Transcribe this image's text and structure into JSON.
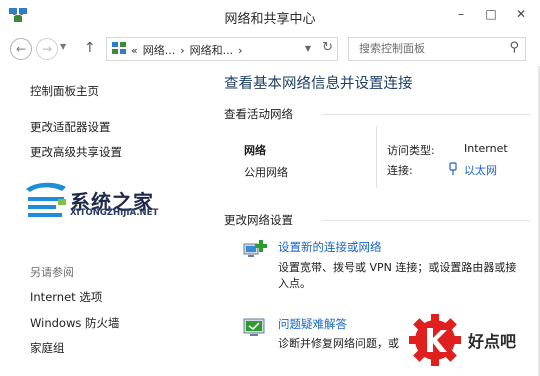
{
  "window": {
    "title": "网络和共享中心"
  },
  "nav": {
    "breadcrumb": [
      "«",
      "网络...",
      "›",
      "网络和...",
      "›"
    ],
    "search_placeholder": "搜索控制面板"
  },
  "sidebar": {
    "items": [
      "控制面板主页",
      "更改适配器设置",
      "更改高级共享设置"
    ],
    "see_also_label": "另请参阅",
    "see_also": [
      "Internet 选项",
      "Windows 防火墙",
      "家庭组"
    ]
  },
  "main": {
    "title": "查看基本网络信息并设置连接",
    "active_section": "查看活动网络",
    "network_name": "网络",
    "network_category": "公用网络",
    "access_type_label": "访问类型:",
    "access_type_value": "Internet",
    "connection_label": "连接:",
    "connection_value": "以太网",
    "change_section": "更改网络设置",
    "tasks": [
      {
        "title": "设置新的连接或网络",
        "desc": "设置宽带、拨号或 VPN 连接；或设置路由器或接入点。"
      },
      {
        "title": "问题疑难解答",
        "desc": "诊断并修复网络问题，或"
      }
    ]
  },
  "watermarks": {
    "site1_title": "系统之家",
    "site1_sub": "XITONGZHIJIA.NET",
    "site2_title": "好点吧"
  },
  "colors": {
    "link": "#1a64c8",
    "title": "#1e3f66"
  }
}
